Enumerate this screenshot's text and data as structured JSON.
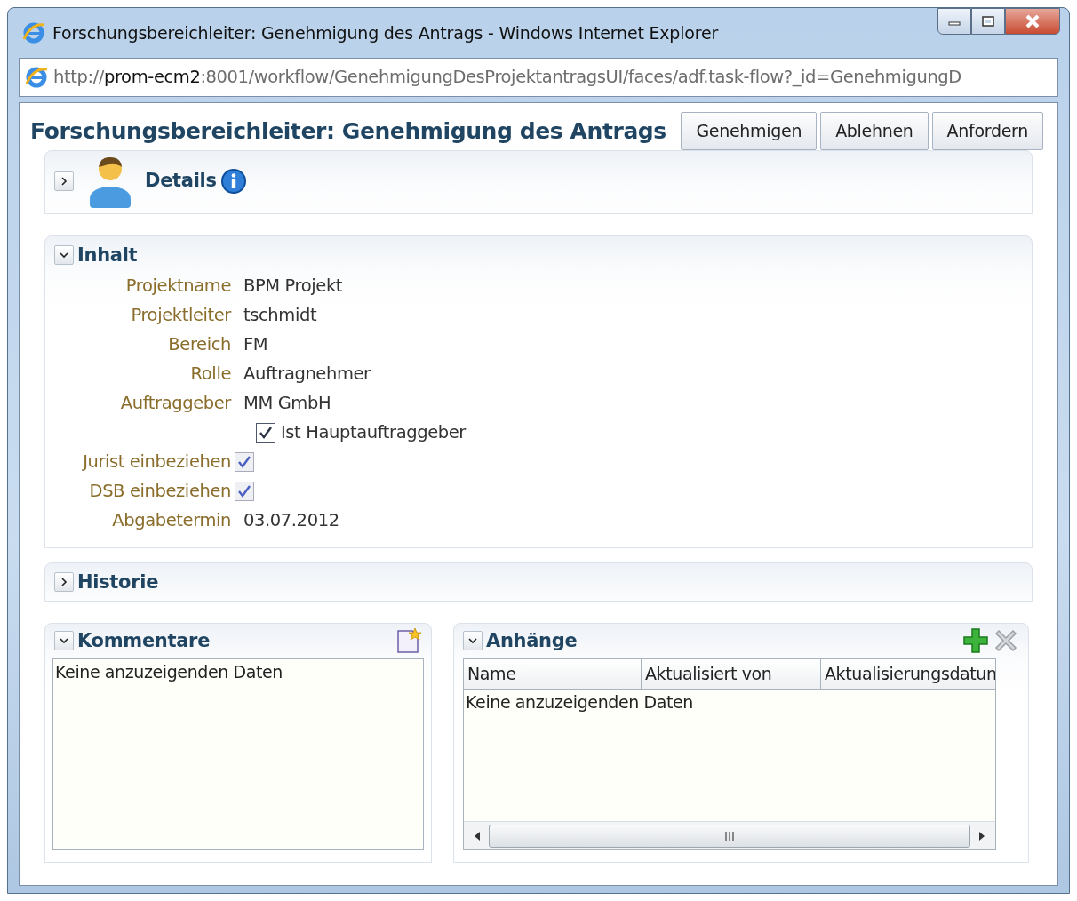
{
  "window": {
    "title": "Forschungsbereichleiter: Genehmigung des Antrags - Windows Internet Explorer"
  },
  "address": {
    "scheme": "http://",
    "host": "prom-ecm2",
    "rest": ":8001/workflow/GenehmigungDesProjektantragsUI/faces/adf.task-flow?_id=GenehmigungD"
  },
  "page": {
    "title": "Forschungsbereichleiter: Genehmigung des Antrags",
    "buttons": [
      "Genehmigen",
      "Ablehnen",
      "Anfordern"
    ]
  },
  "details": {
    "title": "Details",
    "expanded": false
  },
  "inhalt": {
    "title": "Inhalt",
    "expanded": true,
    "fields": [
      {
        "kind": "text",
        "label": "Projektname",
        "value": "BPM Projekt"
      },
      {
        "kind": "text",
        "label": "Projektleiter",
        "value": "tschmidt"
      },
      {
        "kind": "text",
        "label": "Bereich",
        "value": "FM"
      },
      {
        "kind": "text",
        "label": "Rolle",
        "value": "Auftragnehmer"
      },
      {
        "kind": "text",
        "label": "Auftraggeber",
        "value": "MM GmbH"
      },
      {
        "kind": "checkbox",
        "text": "Ist Hauptauftraggeber",
        "checked": true,
        "disabled": false
      },
      {
        "kind": "checkbox",
        "label": "Jurist einbeziehen",
        "checked": true,
        "disabled": true
      },
      {
        "kind": "checkbox",
        "label": "DSB einbeziehen",
        "checked": true,
        "disabled": true
      },
      {
        "kind": "text",
        "label": "Abgabetermin",
        "value": "03.07.2012"
      }
    ]
  },
  "historie": {
    "title": "Historie",
    "expanded": false
  },
  "kommentare": {
    "title": "Kommentare",
    "expanded": true,
    "empty_text": "Keine anzuzeigenden Daten"
  },
  "anhaenge": {
    "title": "Anhänge",
    "expanded": true,
    "columns": [
      "Name",
      "Aktualisiert von",
      "Aktualisierungsdatun"
    ],
    "empty_text": "Keine anzuzeigenden Daten"
  }
}
